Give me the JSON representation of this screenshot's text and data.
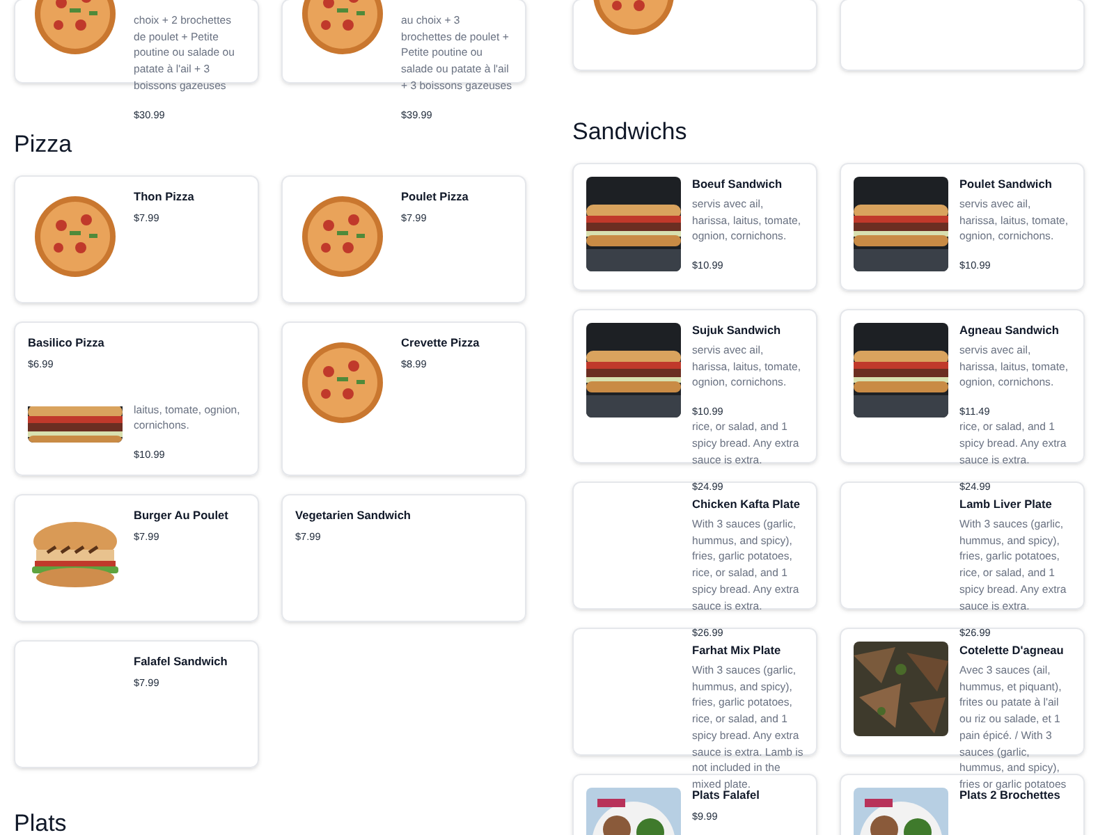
{
  "columns": [
    {
      "sections": [
        {
          "cards": [
            {
              "picture": true,
              "description": "choix + 2 brochettes de poulet + Petite poutine ou salade ou patate à l'ail + 3 boissons gazeuses",
              "price": "$30.99"
            },
            {
              "picture": true,
              "description": "au choix + 3 brochettes de poulet + Petite poutine ou salade ou patate à l'ail + 3 boissons gazeuses",
              "price": "$39.99"
            }
          ]
        },
        {
          "heading": "Pizza",
          "cards": [
            {
              "picture": true,
              "title": "Thon Pizza",
              "price": "$7.99"
            },
            {
              "picture": true,
              "title": "Poulet Pizza",
              "price": "$7.99"
            },
            {
              "title": "Basilico Pizza",
              "price": "$6.99",
              "fragment": {
                "picture": true,
                "description": "laitus, tomate, ognion, cornichons.",
                "price": "$10.99"
              }
            },
            {
              "picture": true,
              "title": "Crevette Pizza",
              "price": "$8.99"
            },
            {
              "picture": true,
              "title": "Burger Au Poulet",
              "price": "$7.99"
            },
            {
              "title": "Vegetarien Sandwich",
              "price": "$7.99"
            },
            {
              "picture": false,
              "title": "Falafel Sandwich",
              "price": "$7.99"
            }
          ]
        },
        {
          "heading": "Plats"
        }
      ]
    },
    {
      "sections": [
        {
          "cards": [
            {
              "picture": true
            },
            {
              "picture": false
            }
          ]
        },
        {
          "heading": "Sandwichs",
          "cards": [
            {
              "picture": true,
              "title": "Boeuf Sandwich",
              "description": "servis avec ail, harissa, laitus, tomate, ognion, cornichons.",
              "price": "$10.99"
            },
            {
              "picture": true,
              "title": "Poulet Sandwich",
              "description": "servis avec ail, harissa, laitus, tomate, ognion, cornichons.",
              "price": "$10.99"
            },
            {
              "picture": true,
              "title": "Sujuk Sandwich",
              "description": "servis avec ail, harissa, laitus, tomate, ognion, cornichons.",
              "price": "$10.99",
              "tail": "rice, or salad, and 1 spicy bread. Any extra sauce is extra."
            },
            {
              "picture": true,
              "title": "Agneau Sandwich",
              "description": "servis avec ail, harissa, laitus, tomate, ognion, cornichons.",
              "price": "$11.49",
              "tail": "rice, or salad, and 1 spicy bread. Any extra sauce is extra."
            },
            {
              "picture": false,
              "lead": "$24.99",
              "title": "Chicken Kafta Plate",
              "description": "With 3 sauces (garlic, hummus, and spicy), fries, garlic potatoes, rice, or salad, and 1 spicy bread. Any extra sauce is extra."
            },
            {
              "picture": false,
              "lead": "$24.99",
              "title": "Lamb Liver Plate",
              "description": "With 3 sauces (garlic, hummus, and spicy), fries, garlic potatoes, rice, or salad, and 1 spicy bread. Any extra sauce is extra."
            },
            {
              "picture": false,
              "lead": "$26.99",
              "title": "Farhat Mix Plate",
              "description": "With 3 sauces (garlic, hummus, and spicy), fries, garlic potatoes, rice, or salad, and 1 spicy bread. Any extra sauce is extra. Lamb is not included in the mixed plate."
            },
            {
              "picture": true,
              "lead": "$26.99",
              "title": "Cotelette D'agneau",
              "description": "Avec 3 sauces (ail, hummus, et piquant), frites ou patate à l'ail ou riz ou salade, et 1 pain épicé. / With 3 sauces (garlic, hummus, and spicy), fries or garlic potatoes"
            },
            {
              "picture": true,
              "title": "Plats Falafel",
              "price": "$9.99"
            },
            {
              "picture": true,
              "title": "Plats 2 Brochettes"
            }
          ]
        }
      ]
    }
  ]
}
